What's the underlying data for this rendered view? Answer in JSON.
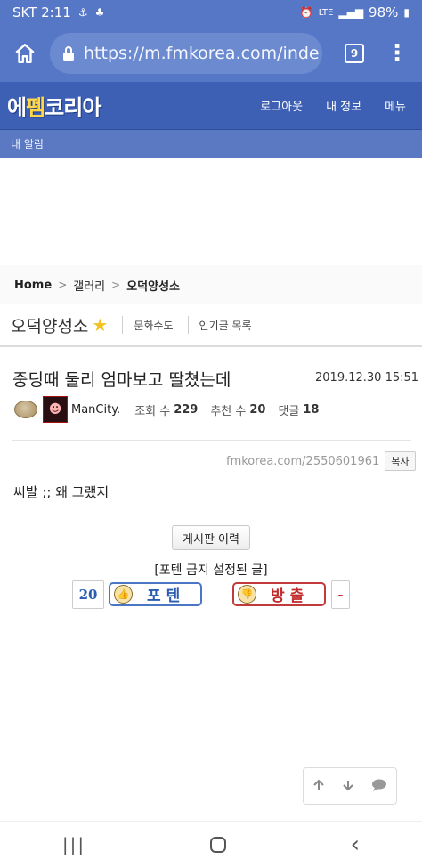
{
  "status_bar": {
    "carrier_time": "SKT 2:11",
    "network": "LTE",
    "battery": "98%"
  },
  "browser": {
    "url": "https://m.fmkorea.com/inde",
    "tab_count": "9"
  },
  "site": {
    "logo": "에펨코리아",
    "logo_accent": "펨",
    "nav": [
      "로그아웃",
      "내 정보",
      "메뉴"
    ],
    "alert": "내 알림"
  },
  "breadcrumb": {
    "home": "Home",
    "gallery": "갤러리",
    "current": "오덕양성소"
  },
  "board": {
    "name": "오덕양성소",
    "links": [
      "문화수도",
      "인기글 목록"
    ]
  },
  "post": {
    "title": "중딩때 둘리 엄마보고 딸쳤는데",
    "date": "2019.12.30 15:51",
    "author": "ManCity.",
    "views_label": "조회 수",
    "views": "229",
    "recommend_label": "추천 수",
    "recommend": "20",
    "comments_label": "댓글",
    "comments": "18",
    "url": "fmkorea.com/2550601961",
    "copy_label": "복사",
    "body": "씨발 ;; 왜 그랬지"
  },
  "actions": {
    "history_label": "게시판 이력",
    "ban_notice": "[포텐 금지 설정된 글]",
    "up_count": "20",
    "up_label": "포텐",
    "down_label": "방출",
    "down_count": "-"
  },
  "icons": [
    "home-icon",
    "lock-icon",
    "star-icon",
    "arrow-up-icon",
    "arrow-down-icon",
    "comment-icon"
  ]
}
